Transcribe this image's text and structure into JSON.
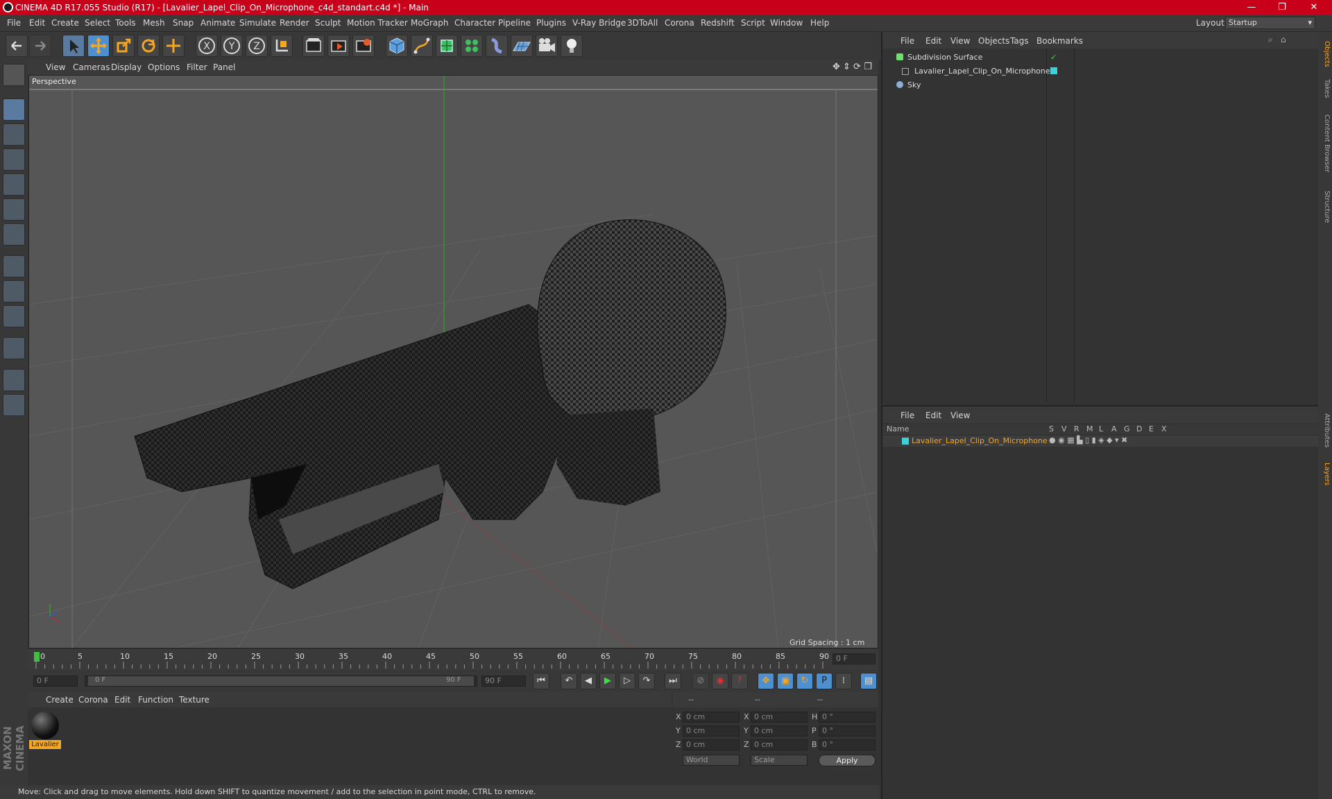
{
  "window": {
    "title": "CINEMA 4D R17.055 Studio (R17) - [Lavalier_Lapel_Clip_On_Microphone_c4d_standart.c4d *] - Main",
    "layout_label": "Layout:",
    "layout_value": "Startup",
    "minimize": "—",
    "maximize": "❐",
    "close": "✕"
  },
  "menubar": [
    "File",
    "Edit",
    "Create",
    "Select",
    "Tools",
    "Mesh",
    "Snap",
    "Animate",
    "Simulate",
    "Render",
    "Sculpt",
    "Motion Tracker",
    "MoGraph",
    "Character",
    "Pipeline",
    "Plugins",
    "V-Ray Bridge",
    "3DToAll",
    "Corona",
    "Redshift",
    "Script",
    "Window",
    "Help"
  ],
  "toolbar": {
    "icons": [
      "undo-icon",
      "redo-icon",
      "select-icon",
      "move-icon",
      "scale-icon",
      "rotate-icon",
      "transform-icon",
      "x-axis-icon",
      "y-axis-icon",
      "z-axis-icon",
      "coordinate-system-icon",
      "render-view-icon",
      "render-picture-viewer-icon",
      "edit-render-settings-icon",
      "cube-icon",
      "pen-icon",
      "subdivision-icon",
      "cloner-icon",
      "deformer-icon",
      "floor-icon",
      "camera-icon",
      "light-icon"
    ]
  },
  "viewport": {
    "menus": [
      "View",
      "Cameras",
      "Display",
      "Options",
      "Filter",
      "Panel"
    ],
    "label": "Perspective",
    "grid_spacing": "Grid Spacing : 1 cm"
  },
  "timeline": {
    "ticks": [
      "0",
      "5",
      "10",
      "15",
      "20",
      "25",
      "30",
      "35",
      "40",
      "45",
      "50",
      "55",
      "60",
      "65",
      "70",
      "75",
      "80",
      "85",
      "90"
    ],
    "current_frame": "0 F",
    "start_field": "0 F",
    "slider_start": "0 F",
    "slider_end": "90 F",
    "end_field": "90 F"
  },
  "materials": {
    "menus": [
      "Create",
      "Corona",
      "Edit",
      "Function",
      "Texture"
    ],
    "items": [
      {
        "name": "Lavalier"
      }
    ]
  },
  "coords": {
    "header": [
      "--",
      "--",
      "--"
    ],
    "rows": [
      {
        "a": "X",
        "av": "0 cm",
        "b": "X",
        "bv": "0 cm",
        "c": "H",
        "cv": "0 °"
      },
      {
        "a": "Y",
        "av": "0 cm",
        "b": "Y",
        "bv": "0 cm",
        "c": "P",
        "cv": "0 °"
      },
      {
        "a": "Z",
        "av": "0 cm",
        "b": "Z",
        "bv": "0 cm",
        "c": "B",
        "cv": "0 °"
      }
    ],
    "mode": "World",
    "type": "Scale",
    "apply": "Apply"
  },
  "object_manager": {
    "menus": [
      "File",
      "Edit",
      "View",
      "Objects",
      "Tags",
      "Bookmarks"
    ],
    "objects": [
      {
        "name": "Subdivision Surface",
        "color": "#6fe06f"
      },
      {
        "name": "Lavalier_Lapel_Clip_On_Microphone",
        "color": "#3ed0d8"
      },
      {
        "name": "Sky",
        "color": "#8ab0d8"
      }
    ]
  },
  "layer_manager": {
    "menus": [
      "File",
      "Edit",
      "View"
    ],
    "columns": [
      "Name",
      "S",
      "V",
      "R",
      "M",
      "L",
      "A",
      "G",
      "D",
      "E",
      "X"
    ],
    "layers": [
      {
        "name": "Lavalier_Lapel_Clip_On_Microphone",
        "color": "#3ed0d8"
      }
    ]
  },
  "right_tabs": [
    "Objects",
    "Takes",
    "Content Browser",
    "Structure",
    "Attributes",
    "Layers"
  ],
  "branding": "MAXON CINEMA 4D",
  "status": "Move: Click and drag to move elements. Hold down SHIFT to quantize movement / add to the selection in point mode, CTRL to remove.",
  "colors": {
    "title_bar": "#c8001a",
    "accent_orange": "#f5a623",
    "active_blue": "#4e8fd0"
  }
}
